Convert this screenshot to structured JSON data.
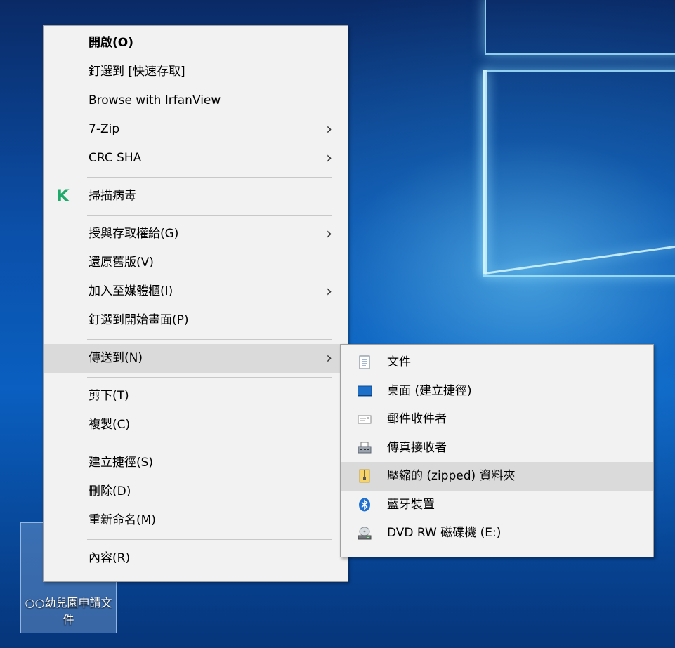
{
  "desktop": {
    "icon_label": "○○幼兒園申請文件"
  },
  "context_menu": {
    "items": [
      {
        "label": "開啟(O)",
        "bold": true
      },
      {
        "label": "釘選到 [快速存取]"
      },
      {
        "label": "Browse with IrfanView"
      },
      {
        "label": "7-Zip",
        "submenu": true
      },
      {
        "label": "CRC SHA",
        "submenu": true
      },
      {
        "label": "掃描病毒",
        "icon": "kaspersky-k-icon"
      },
      {
        "label": "授與存取權給(G)",
        "submenu": true
      },
      {
        "label": "還原舊版(V)"
      },
      {
        "label": "加入至媒體櫃(I)",
        "submenu": true
      },
      {
        "label": "釘選到開始畫面(P)"
      },
      {
        "label": "傳送到(N)",
        "submenu": true,
        "highlighted": true
      },
      {
        "label": "剪下(T)"
      },
      {
        "label": "複製(C)"
      },
      {
        "label": "建立捷徑(S)"
      },
      {
        "label": "刪除(D)"
      },
      {
        "label": "重新命名(M)"
      },
      {
        "label": "內容(R)"
      }
    ],
    "arrow_glyph": "›"
  },
  "send_to_menu": {
    "items": [
      {
        "label": "文件",
        "icon": "document-icon"
      },
      {
        "label": "桌面 (建立捷徑)",
        "icon": "desktop-icon"
      },
      {
        "label": "郵件收件者",
        "icon": "mail-recipient-icon"
      },
      {
        "label": "傳真接收者",
        "icon": "fax-icon"
      },
      {
        "label": "壓縮的 (zipped) 資料夾",
        "icon": "zip-folder-icon",
        "highlighted": true
      },
      {
        "label": "藍牙裝置",
        "icon": "bluetooth-icon"
      },
      {
        "label": "DVD RW 磁碟機 (E:)",
        "icon": "dvd-drive-icon"
      }
    ]
  },
  "colors": {
    "menu_bg": "#f2f2f2",
    "menu_highlight": "#dadada",
    "kaspersky_green": "#1fa96b",
    "desktop_blue": "#0b4fa8"
  }
}
